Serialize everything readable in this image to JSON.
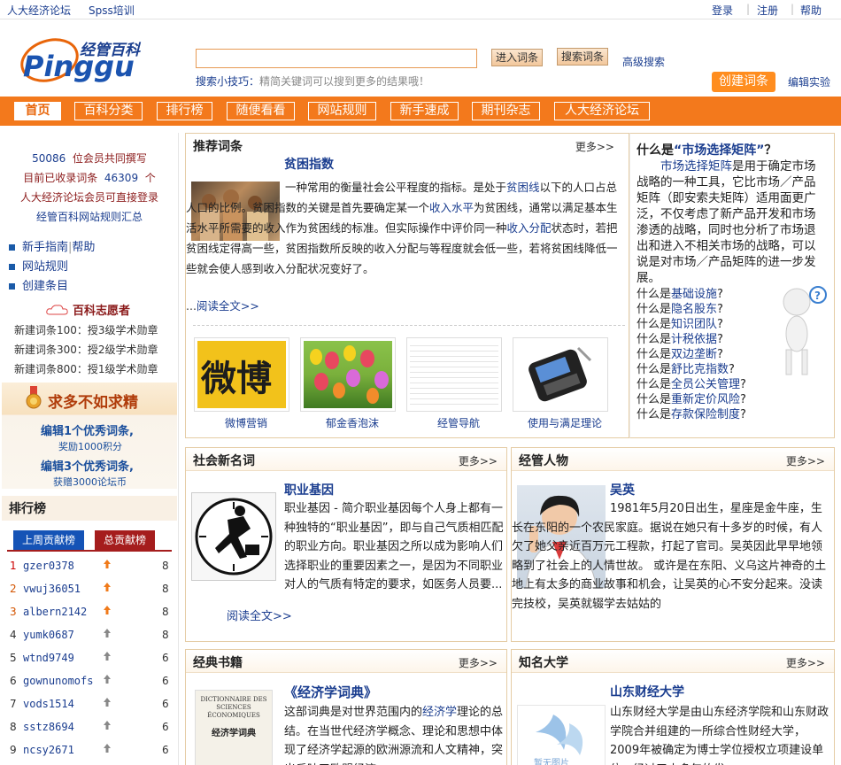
{
  "topbar": {
    "left_links": [
      "人大经济论坛",
      "Spss培训"
    ],
    "right_links": [
      "登录",
      "注册",
      "帮助"
    ],
    "separator": "|"
  },
  "header": {
    "logo_alt": "经管百科 Pinggu",
    "logo_cn": "经管百科",
    "logo_en": "Pinggu",
    "search_value": "",
    "enter_btn": "进入词条",
    "search_btn": "搜索词条",
    "advanced": "高级搜索",
    "tips_label": "搜索小技巧：",
    "tips_text": "精简关键词可以搜到更多的结果哦！",
    "create_btn": "创建词条",
    "edit_exp": "编辑实验"
  },
  "nav": [
    "首页",
    "百科分类",
    "排行榜",
    "随便看看",
    "网站规则",
    "新手速成",
    "期刊杂志",
    "人大经济论坛"
  ],
  "sidebar": {
    "stat1_num": "50086",
    "stat1_text": "位会员共同撰写",
    "stat2_text": "目前已收录词条",
    "stat2_num": "46309",
    "stat2_unit": "个",
    "stat3": "人大经济论坛会员可直接登录",
    "stat4": "经管百科网站规则汇总",
    "links": [
      "新手指南",
      "帮助",
      "网站规则",
      "创建条目"
    ],
    "volunteer_title": "百科志愿者",
    "volunteer_rules": [
      "新建词条100：授3级学术勋章",
      "新建词条300：授2级学术勋章",
      "新建词条800：授1级学术勋章"
    ],
    "banner": {
      "title": "求多不如求精",
      "line1": "编辑1个优秀词条,",
      "sub1": "奖励1000积分",
      "line2": "编辑3个优秀词条,",
      "sub2": "获赠3000论坛币"
    },
    "rank_title": "排行榜",
    "rank_tabs": [
      "上周贡献榜",
      "总贡献榜"
    ],
    "rank": [
      {
        "no": "1",
        "name": "gzer0378",
        "score": "8",
        "up": true
      },
      {
        "no": "2",
        "name": "vwuj36051",
        "score": "8",
        "up": true
      },
      {
        "no": "3",
        "name": "albern2142",
        "score": "8",
        "up": true
      },
      {
        "no": "4",
        "name": "yumk0687",
        "score": "8",
        "up": false
      },
      {
        "no": "5",
        "name": "wtnd9749",
        "score": "6",
        "up": false
      },
      {
        "no": "6",
        "name": "gownunomofs",
        "score": "6",
        "up": false
      },
      {
        "no": "7",
        "name": "vods1514",
        "score": "6",
        "up": false
      },
      {
        "no": "8",
        "name": "sstz8694",
        "score": "6",
        "up": false
      },
      {
        "no": "9",
        "name": "ncsy2671",
        "score": "6",
        "up": false
      }
    ]
  },
  "recommend": {
    "title": "推荐词条",
    "more": "更多>>",
    "entry_title": "贫困指数",
    "read_more": "阅读全文>>",
    "ellipsis": "...",
    "p_intro": "一种常用的衡量社会公平程度的指标。是处于",
    "link1": "贫困线",
    "p_2": "以下的人口占总人口的比例。贫困指数的关键是首先要确定某一个",
    "link2": "收入水平",
    "p_3": "为贫困线，通常以满足基本生活水平所需要的收入作为贫困线的标准。但实际操作中评价同一种",
    "link3": "收入分配",
    "p_4": "状态时，若把贫困线定得高一些，贫困指数所反映的收入分配与等程度就会低一些，若将贫困线降低一些就会使人感到收入分配状况变好了。",
    "thumbs": [
      "微博营销",
      "郁金香泡沫",
      "经管导航",
      "使用与满足理论"
    ],
    "thumb1_text": "微博"
  },
  "faq": {
    "q_prefix": "什么是",
    "q_term": "“市场选择矩阵”",
    "q_suffix": "？",
    "answer_link": "市场选择矩阵",
    "answer_text": "是用于确定市场战略的一种工具，它比市场／产品矩阵（即安索夫矩阵）适用面更广泛，不仅考虑了新产品开发和市场渗透的战略，同时也分析了市场退出和进入不相关市场的战略，可以说是对市场／产品矩阵的进一步发展。",
    "help_icon": "?",
    "items": [
      {
        "pre": "什么是",
        "term": "基础设施",
        "post": "?"
      },
      {
        "pre": "什么是",
        "term": "隐名股东",
        "post": "?"
      },
      {
        "pre": "什么是",
        "term": "知识团队",
        "post": "?"
      },
      {
        "pre": "什么是",
        "term": "计税依据",
        "post": "?"
      },
      {
        "pre": "什么是",
        "term": "双边垄断",
        "post": "?"
      },
      {
        "pre": "什么是",
        "term": "舒比克指数",
        "post": "?"
      },
      {
        "pre": "什么是",
        "term": "全员公关管理",
        "post": "?"
      },
      {
        "pre": "什么是",
        "term": "重新定价风险",
        "post": "?"
      },
      {
        "pre": "什么是",
        "term": "存款保险制度",
        "post": "?"
      }
    ]
  },
  "social": {
    "title": "社会新名词",
    "more": "更多>>",
    "entry_title": "职业基因",
    "text": "职业基因 - 简介职业基因每个人身上都有一种独特的“职业基因”，即与自己气质相匹配的职业方向。职业基因之所以成为影响人们选择职业的重要因素之一，是因为不同职业对人的气质有特定的要求，如医务人员要...",
    "read_more": "阅读全文>>"
  },
  "people": {
    "title": "经管人物",
    "more": "更多>>",
    "entry_title": "吴英",
    "text": "1981年5月20日出生，星座是金牛座，生长在东阳的一个农民家庭。据说在她只有十多岁的时候，有人欠了她父亲近百万元工程款，打起了官司。吴英因此早早地领略到了社会上的人情世故。 或许是在东阳、义乌这片神奇的土地上有太多的商业故事和机会，让吴英的心不安分起来。没读完技校，吴英就辍学去姑姑的"
  },
  "books": {
    "title": "经典书籍",
    "more": "更多>>",
    "entry_title": "《经济学词典》",
    "cover_fr": "DICTIONNAIRE DES SCIENCES ÉCONOMIQUES",
    "cover_cn": "经济学词典",
    "p_a": "这部词典是对世界范围内的",
    "link": "经济学",
    "p_b": "理论的总结。在当世代经济学概念、理论和思想中体现了经济学起源的欧洲源流和人文精神，突出反映了欧盟经济"
  },
  "univ": {
    "title": "知名大学",
    "more": "更多>>",
    "entry_title": "山东财经大学",
    "text": "山东财经大学是由山东经济学院和山东财政学院合并组建的一所综合性财经大学，2009年被确定为博士学位授权立项建设单位，经过五十多年的发",
    "img_label": "暂无图片"
  }
}
